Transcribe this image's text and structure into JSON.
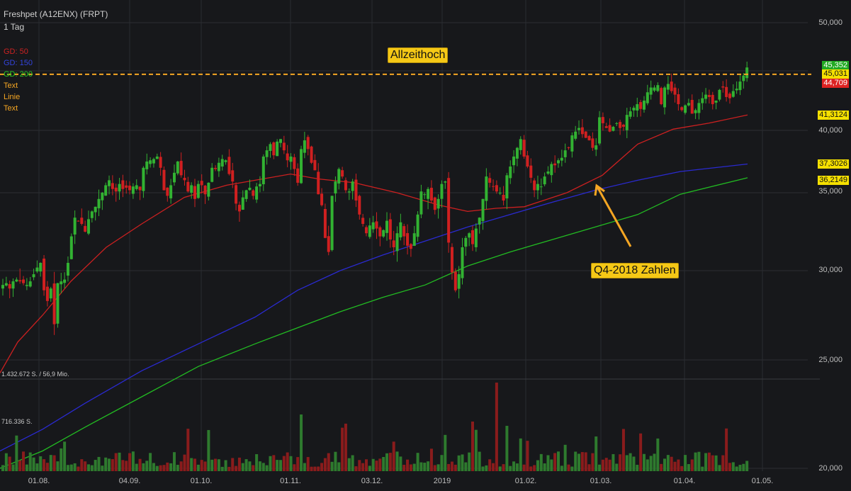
{
  "header": {
    "title": "Freshpet (A12ENX) (FRPT)",
    "interval": "1 Tag"
  },
  "legend": [
    {
      "label": "GD: 50",
      "color": "#cc2222"
    },
    {
      "label": "GD: 150",
      "color": "#2233cc"
    },
    {
      "label": "GD: 200",
      "color": "#22cc22"
    },
    {
      "label": "Text",
      "color": "#f5a623"
    },
    {
      "label": "Linie",
      "color": "#f5a623"
    },
    {
      "label": "Text",
      "color": "#f5a623"
    }
  ],
  "volume_labels": {
    "max": "1.432.672 S. / 56,9 Mio.",
    "mid": "716.336 S."
  },
  "price_tags": [
    {
      "label": "45,352",
      "bg": "#22aa22"
    },
    {
      "label": "45,031",
      "bg": "#f5e000"
    },
    {
      "label": "44,709",
      "bg": "#dd2222"
    },
    {
      "label": "41,3124",
      "bg": "#f5e000"
    },
    {
      "label": "37,3026",
      "bg": "#f5e000"
    },
    {
      "label": "36,2149",
      "bg": "#f5e000"
    }
  ],
  "annotations": {
    "ath": "Allzeithoch",
    "q4": "Q4-2018 Zahlen"
  },
  "chart_data": {
    "type": "candlestick",
    "title": "Freshpet (A12ENX) (FRPT)",
    "y_axis": {
      "min": 20000,
      "max": 50000,
      "ticks": [
        "50,000",
        "45,000",
        "40,000",
        "35,000",
        "30,000",
        "25,000",
        "20,000"
      ],
      "tick_values": [
        50,
        45,
        40,
        35,
        30,
        25,
        20
      ]
    },
    "x_ticks": [
      "01.08.",
      "04.09.",
      "01.10.",
      "01.11.",
      "03.12.",
      "2019",
      "01.02.",
      "01.03.",
      "01.04.",
      "01.05."
    ],
    "horizontal_line": {
      "value": 44.709,
      "color": "#f5a623",
      "style": "dashed"
    },
    "close_series": [
      29.2,
      29.3,
      29.0,
      29.4,
      29.5,
      29.4,
      29.3,
      29.2,
      29.4,
      29.8,
      30.2,
      30.5,
      28.9,
      28.3,
      29.0,
      27.0,
      29.3,
      29.4,
      29.5,
      30.5,
      32.2,
      33.4,
      33.2,
      33.0,
      32.5,
      33.3,
      33.8,
      34.1,
      34.6,
      35.0,
      35.6,
      36.0,
      35.3,
      35.1,
      35.7,
      35.3,
      35.4,
      35.2,
      35.5,
      35.6,
      35.2,
      37.0,
      37.5,
      37.6,
      37.7,
      37.9,
      37.0,
      35.2,
      34.8,
      35.6,
      36.6,
      37.5,
      36.4,
      36.0,
      35.1,
      35.6,
      34.6,
      35.7,
      35.6,
      34.9,
      35.8,
      37.0,
      36.9,
      37.4,
      37.7,
      37.6,
      36.5,
      35.9,
      34.3,
      33.8,
      34.7,
      35.2,
      35.4,
      34.8,
      35.5,
      35.7,
      37.9,
      38.4,
      38.9,
      38.0,
      39.1,
      39.3,
      38.4,
      37.6,
      37.9,
      36.9,
      35.8,
      38.5,
      39.2,
      38.5,
      37.4,
      36.8,
      34.9,
      34.2,
      32.1,
      31.2,
      34.8,
      35.9,
      36.9,
      36.3,
      35.2,
      35.1,
      35.9,
      34.5,
      33.6,
      33.0,
      32.4,
      32.9,
      33.1,
      32.7,
      32.2,
      32.6,
      33.2,
      32.0,
      31.5,
      32.4,
      33.1,
      32.2,
      31.6,
      31.4,
      32.4,
      33.6,
      35.1,
      34.9,
      35.3,
      34.5,
      33.9,
      34.6,
      35.7,
      35.9,
      31.8,
      29.9,
      28.9,
      29.8,
      31.5,
      32.1,
      32.4,
      31.7,
      32.7,
      33.4,
      34.6,
      36.3,
      35.8,
      35.5,
      35.1,
      35.0,
      34.5,
      36.4,
      37.1,
      37.9,
      38.6,
      39.3,
      37.9,
      37.1,
      36.2,
      35.2,
      35.7,
      35.5,
      36.3,
      36.7,
      37.3,
      37.2,
      37.6,
      37.8,
      38.4,
      38.6,
      39.6,
      39.9,
      40.2,
      39.7,
      39.4,
      39.2,
      38.6,
      38.8,
      41.1,
      40.6,
      40.2,
      39.9,
      40.3,
      40.6,
      40.2,
      40.3,
      41.3,
      41.6,
      41.9,
      42.2,
      41.8,
      42.5,
      43.2,
      43.6,
      43.6,
      43.8,
      42.2,
      43.6,
      43.9,
      43.3,
      43.0,
      42.2,
      41.7,
      42.1,
      42.3,
      41.4,
      41.7,
      42.3,
      42.7,
      43.0,
      42.8,
      42.2,
      42.5,
      43.4,
      43.6,
      42.8,
      42.7,
      43.3,
      43.5,
      44.1,
      44.6,
      45.35
    ],
    "sma_50": [
      [
        0,
        24.4
      ],
      [
        25,
        26.0
      ],
      [
        60,
        27.5
      ],
      [
        100,
        29.4
      ],
      [
        150,
        31.5
      ],
      [
        200,
        33.0
      ],
      [
        260,
        34.7
      ],
      [
        320,
        35.6
      ],
      [
        380,
        36.2
      ],
      [
        410,
        36.5
      ],
      [
        450,
        36.1
      ],
      [
        500,
        35.8
      ],
      [
        560,
        35.0
      ],
      [
        590,
        34.6
      ],
      [
        620,
        34.2
      ],
      [
        660,
        33.8
      ],
      [
        700,
        34.0
      ],
      [
        740,
        34.1
      ],
      [
        800,
        35.0
      ],
      [
        850,
        36.4
      ],
      [
        900,
        38.9
      ],
      [
        950,
        40.1
      ],
      [
        1000,
        40.6
      ],
      [
        1055,
        41.3
      ]
    ],
    "sma_150": [
      [
        0,
        20.8
      ],
      [
        60,
        21.8
      ],
      [
        120,
        23.0
      ],
      [
        200,
        24.5
      ],
      [
        280,
        25.9
      ],
      [
        360,
        27.4
      ],
      [
        420,
        28.9
      ],
      [
        480,
        30.0
      ],
      [
        540,
        31.0
      ],
      [
        600,
        31.9
      ],
      [
        660,
        32.8
      ],
      [
        720,
        33.6
      ],
      [
        780,
        34.4
      ],
      [
        840,
        35.2
      ],
      [
        900,
        36.0
      ],
      [
        960,
        36.7
      ],
      [
        1055,
        37.3
      ]
    ],
    "sma_200": [
      [
        0,
        19.8
      ],
      [
        60,
        20.8
      ],
      [
        120,
        21.9
      ],
      [
        200,
        23.3
      ],
      [
        280,
        24.7
      ],
      [
        360,
        25.9
      ],
      [
        420,
        26.8
      ],
      [
        480,
        27.7
      ],
      [
        540,
        28.5
      ],
      [
        600,
        29.2
      ],
      [
        660,
        30.3
      ],
      [
        720,
        31.2
      ],
      [
        780,
        32.0
      ],
      [
        840,
        32.8
      ],
      [
        900,
        33.6
      ],
      [
        960,
        34.9
      ],
      [
        1055,
        36.2
      ]
    ]
  }
}
